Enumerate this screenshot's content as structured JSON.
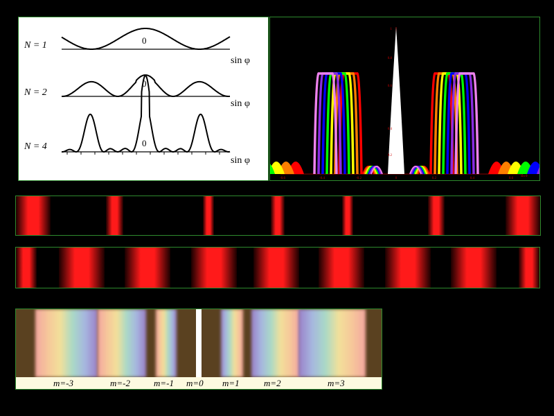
{
  "curves_panel": {
    "rows": [
      {
        "n_label": "N = 1",
        "zero_label": "0",
        "axis_label": "sin φ"
      },
      {
        "n_label": "N = 2",
        "zero_label": "0",
        "axis_label": "sin φ"
      },
      {
        "n_label": "N = 4",
        "zero_label": "0",
        "axis_label": "sin φ"
      }
    ]
  },
  "spectrum_panel": {
    "y_tick_labels": [
      "1",
      "0.8",
      "0.6",
      "0.4",
      "0.2"
    ],
    "x_tick_labels": [
      "-0.6",
      "-0.4",
      "-0.2",
      "0",
      "0.2",
      "0.4",
      "0.6"
    ],
    "x_axis_label": "sin θ",
    "series_colors": [
      "#ff0000",
      "#ff7f00",
      "#ffff00",
      "#00ff00",
      "#0000ff",
      "#8a2be2",
      "#ee82ee"
    ],
    "central_color": "#ffffff"
  },
  "fringe_strip_1": {
    "color": "#ff0000",
    "description_colors": [
      "#000000",
      "#ff0000"
    ]
  },
  "fringe_strip_2": {
    "color": "#ff0000"
  },
  "color_spectrum": {
    "background": "#5a4120",
    "order_labels": [
      "m=-3",
      "m=-2",
      "m=-1",
      "m=0",
      "m=1",
      "m=2",
      "m=3"
    ]
  }
}
